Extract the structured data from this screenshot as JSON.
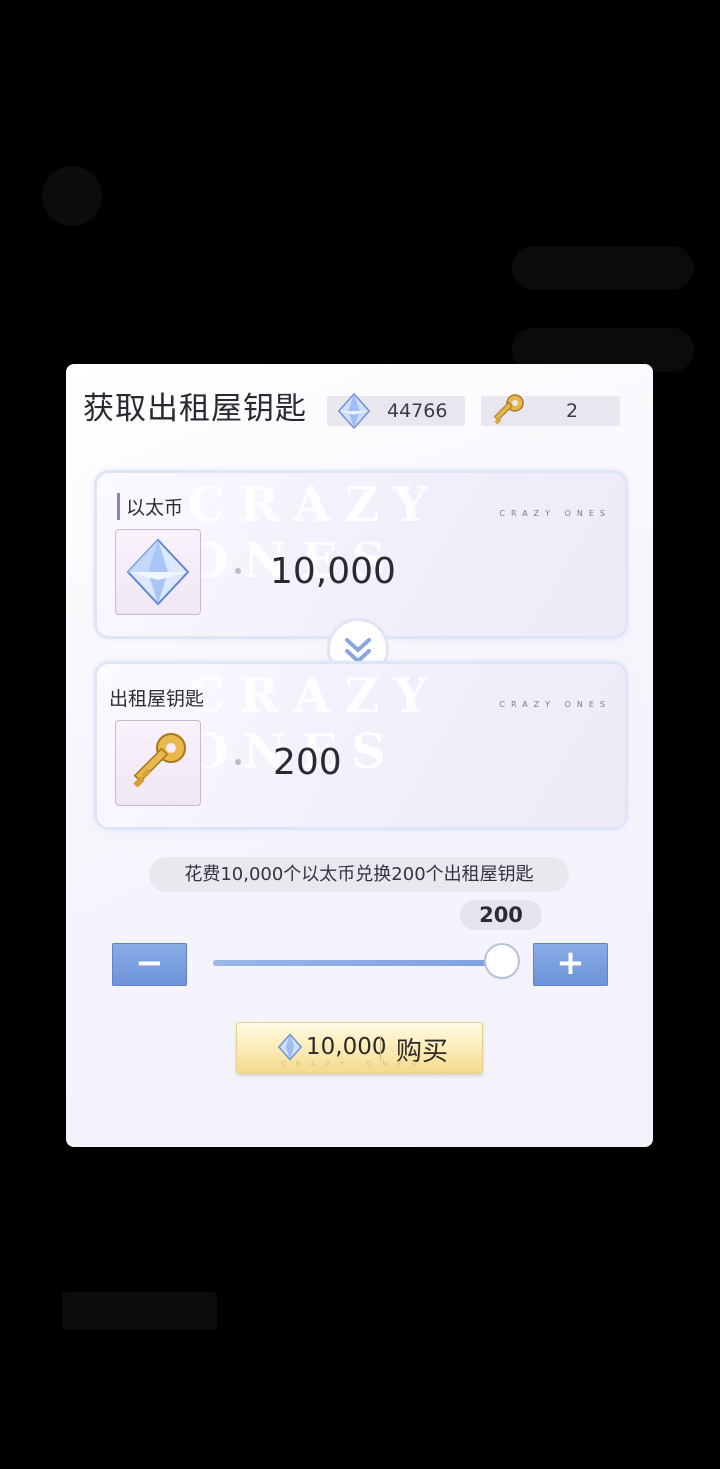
{
  "dialog": {
    "title": "获取出租屋钥匙",
    "ether_balance": "44766",
    "key_balance": "2"
  },
  "cost_card": {
    "label": "以太币",
    "amount": "10,000",
    "watermark": "CRAZY ONES",
    "watermark_small": "CRAZY ONES"
  },
  "reward_card": {
    "label": "出租屋钥匙",
    "amount": "200",
    "watermark": "CRAZY ONES",
    "watermark_small": "CRAZY ONES"
  },
  "exchange_note": "花费10,000个以太币兑换200个出租屋钥匙",
  "quantity": {
    "value": "200",
    "minus_label": "−",
    "plus_label": "+",
    "slider_fraction": 1.0
  },
  "buy_button": {
    "price": "10,000",
    "label": "购买",
    "watermark": "CRAZY ONES"
  },
  "colors": {
    "accent_blue": "#7a9de0",
    "gold": "#f4d98c",
    "dim_overlay": "#000000"
  },
  "icons": [
    "crystal-icon",
    "key-icon",
    "double-chevron-down-icon"
  ]
}
